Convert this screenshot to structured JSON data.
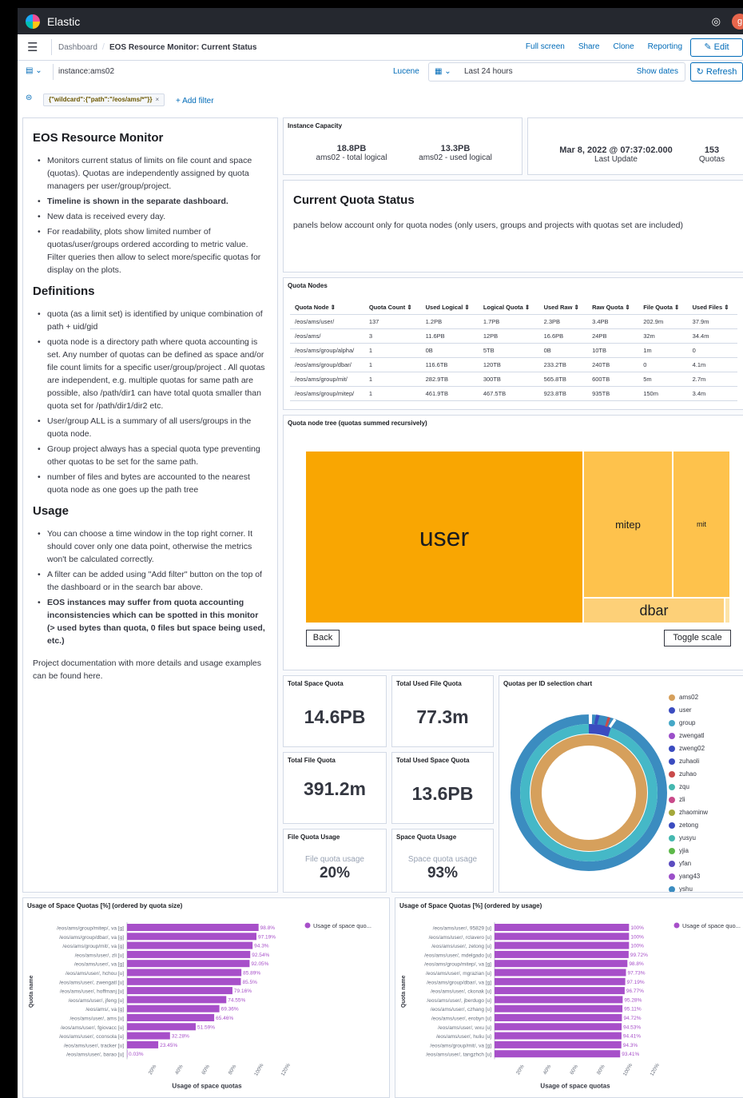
{
  "app": {
    "brand": "Elastic",
    "avatar": "g"
  },
  "nav": {
    "crumb_root": "Dashboard",
    "crumb_current": "EOS Resource Monitor: Current Status",
    "links": [
      "Full screen",
      "Share",
      "Clone",
      "Reporting"
    ],
    "edit": "Edit"
  },
  "query": {
    "value": "instance:ams02",
    "language": "Lucene",
    "time_range": "Last 24 hours",
    "show_dates": "Show dates",
    "refresh": "Refresh"
  },
  "filters": {
    "pill": "{\"wildcard\":{\"path\":\"/eos/ams/*\"}}",
    "add_filter": "+ Add filter"
  },
  "markdown": {
    "title": "EOS Resource Monitor",
    "intro": [
      "Monitors current status of limits on file count and space (quotas). Quotas are independently assigned by quota managers per user/group/project.",
      "Timeline is shown in the separate dashboard.",
      "New data is received every day.",
      "For readability, plots show limited number of quotas/user/groups ordered according to metric value. Filter queries then allow to select more/specific quotas for display on the plots."
    ],
    "definitions_title": "Definitions",
    "definitions": [
      "quota (as a limit set) is identified by unique combination of path + uid/gid",
      "quota node is a directory path where quota accounting is set. Any number of quotas can be defined as space and/or file count limits for a specific user/group/project . All quotas are independent, e.g. multiple quotas for same path are possible, also /path/dir1 can have total quota smaller than quota set for /path/dir1/dir2 etc.",
      "User/group ALL is a summary of all users/groups in the quota node.",
      "Group project always has a special quota type preventing other quotas to be set for the same path.",
      "number of files and bytes are accounted to the nearest quota node as one goes up the path tree"
    ],
    "usage_title": "Usage",
    "usage": [
      "You can choose a time window in the top right corner. It should cover only one data point, otherwise the metrics won't be calculated correctly.",
      "A filter can be added using \"Add filter\" button on the top of the dashboard or in the search bar above.",
      "EOS instances may suffer from quota accounting inconsistencies which can be spotted in this monitor (> used bytes than quota, 0 files but space being used, etc.)"
    ],
    "footer": "Project documentation with more details and usage examples can be found here."
  },
  "capacity": {
    "title": "Instance Capacity",
    "total_value": "18.8PB",
    "total_label": "ams02 - total logical",
    "used_value": "13.3PB",
    "used_label": "ams02 - used logical"
  },
  "update": {
    "date": "Mar 8, 2022 @ 07:37:02.000",
    "date_label": "Last Update",
    "quotas": "153",
    "quotas_label": "Quotas"
  },
  "status": {
    "title": "Current Quota Status",
    "text": "panels below account only for quota nodes (only users, groups and projects with quotas set are included)"
  },
  "quota_nodes": {
    "title": "Quota Nodes",
    "headers": [
      "Quota Node ⇕",
      "Quota Count ⇕",
      "Used Logical ⇕",
      "Logical Quota ⇕",
      "Used Raw ⇕",
      "Raw Quota ⇕",
      "File Quota ⇕",
      "Used Files ⇕"
    ],
    "rows": [
      [
        "/eos/ams/user/",
        "137",
        "1.2PB",
        "1.7PB",
        "2.3PB",
        "3.4PB",
        "202.9m",
        "37.9m"
      ],
      [
        "/eos/ams/",
        "3",
        "11.6PB",
        "12PB",
        "16.6PB",
        "24PB",
        "32m",
        "34.4m"
      ],
      [
        "/eos/ams/group/alpha/",
        "1",
        "0B",
        "5TB",
        "0B",
        "10TB",
        "1m",
        "0"
      ],
      [
        "/eos/ams/group/dbar/",
        "1",
        "116.6TB",
        "120TB",
        "233.2TB",
        "240TB",
        "0",
        "4.1m"
      ],
      [
        "/eos/ams/group/mit/",
        "1",
        "282.9TB",
        "300TB",
        "565.8TB",
        "600TB",
        "5m",
        "2.7m"
      ],
      [
        "/eos/ams/group/mitep/",
        "1",
        "461.9TB",
        "467.5TB",
        "923.8TB",
        "935TB",
        "150m",
        "3.4m"
      ]
    ]
  },
  "treemap": {
    "title": "Quota node tree (quotas summed recursively)",
    "cells": [
      "user",
      "mitep",
      "mit",
      "dbar"
    ],
    "back": "Back",
    "toggle": "Toggle scale",
    "colors": [
      "#f9a602",
      "#fec24c",
      "#fec24c",
      "#fdd078"
    ]
  },
  "metrics": {
    "total_space_quota": {
      "title": "Total Space Quota",
      "value": "14.6PB"
    },
    "total_used_file_quota": {
      "title": "Total Used File Quota",
      "value": "77.3m"
    },
    "total_file_quota": {
      "title": "Total File Quota",
      "value": "391.2m"
    },
    "total_used_space_quota": {
      "title": "Total Used Space Quota",
      "value": "13.6PB"
    },
    "file_quota_usage": {
      "title": "File Quota Usage",
      "label": "File quota usage",
      "value": "20%"
    },
    "space_quota_usage": {
      "title": "Space Quota Usage",
      "label": "Space quota usage",
      "value": "93%"
    }
  },
  "donut": {
    "title": "Quotas per ID selection chart",
    "legend": [
      {
        "name": "ams02",
        "color": "#d6a05c"
      },
      {
        "name": "user",
        "color": "#3b4cc0"
      },
      {
        "name": "group",
        "color": "#45a8c7"
      },
      {
        "name": "zwengatl",
        "color": "#9b4fc9"
      },
      {
        "name": "zweng02",
        "color": "#3b4cc0"
      },
      {
        "name": "zuhaoli",
        "color": "#3b4cc0"
      },
      {
        "name": "zuhao",
        "color": "#c94a4a"
      },
      {
        "name": "zqu",
        "color": "#45b8b0"
      },
      {
        "name": "zli",
        "color": "#c94a8a"
      },
      {
        "name": "zhaominw",
        "color": "#a4a83a"
      },
      {
        "name": "zetong",
        "color": "#3b4cc0"
      },
      {
        "name": "yusyu",
        "color": "#45b8b0"
      },
      {
        "name": "yjia",
        "color": "#5db84a"
      },
      {
        "name": "yfan",
        "color": "#5b4cc0"
      },
      {
        "name": "yang43",
        "color": "#9b4fc9"
      },
      {
        "name": "yshu",
        "color": "#3b8cc0"
      }
    ]
  },
  "chart_data": [
    {
      "type": "bar",
      "title": "Usage of Space Quotas [%] (ordered by quota size)",
      "xlabel": "Usage of space quotas",
      "ylabel": "Quota name",
      "legend": "Usage of space quo...",
      "xlim": [
        0,
        120
      ],
      "xticks": [
        "20%",
        "40%",
        "60%",
        "80%",
        "100%",
        "120%"
      ],
      "categories": [
        "/eos/ams/group/mitep/, va [g]",
        "/eos/ams/group/dbar/, va [g]",
        "/eos/ams/group/mit/, va [g]",
        "/eos/ams/user/, zli [u]",
        "/eos/ams/user/, va [g]",
        "/eos/ams/user/, hchou [u]",
        "/eos/ams/user/, zwengatl [u]",
        "/eos/ams/user/, hoffmanj [u]",
        "/eos/ams/user/, jfeng [u]",
        "/eos/ams/, va [g]",
        "/eos/ams/user/, ams [u]",
        "/eos/ams/user/, fgiovacc [u]",
        "/eos/ams/user/, cconsola [u]",
        "/eos/ams/user/, tracker [u]",
        "/eos/ams/user/, barao [u]"
      ],
      "values": [
        98.8,
        97.19,
        94.3,
        92.54,
        92.05,
        85.89,
        85.5,
        79.16,
        74.55,
        69.36,
        65.46,
        51.59,
        32.28,
        23.45,
        0.03
      ],
      "labels": [
        "98.8%",
        "97.19%",
        "94.3%",
        "92.54%",
        "92.05%",
        "85.89%",
        "85.5%",
        "79.16%",
        "74.55%",
        "69.36%",
        "65.46%",
        "51.59%",
        "32.28%",
        "23.45%",
        "0.03%"
      ],
      "color": "#a74fc9"
    },
    {
      "type": "bar",
      "title": "Usage of Space Quotas [%] (ordered by usage)",
      "xlabel": "Usage of space quotas",
      "ylabel": "Quota name",
      "legend": "Usage of space quo...",
      "xlim": [
        0,
        120
      ],
      "xticks": [
        "20%",
        "40%",
        "60%",
        "80%",
        "100%",
        "120%"
      ],
      "categories": [
        "/eos/ams/user/, 95829 [u]",
        "/eos/ams/user/, rclavero [u]",
        "/eos/ams/user/, zetong [u]",
        "/eos/ams/user/, mdelgado [u]",
        "/eos/ams/group/mitep/, va [g]",
        "/eos/ams/user/, mgrazian [u]",
        "/eos/ams/group/dbar/, va [g]",
        "/eos/ams/user/, ckonak [u]",
        "/eos/ams/user/, jberdugo [u]",
        "/eos/ams/user/, czhang [u]",
        "/eos/ams/user/, erobyn [u]",
        "/eos/ams/user/, wxu [u]",
        "/eos/ams/user/, huliu [u]",
        "/eos/ams/group/mit/, va [g]",
        "/eos/ams/user/, tangzhch [u]"
      ],
      "values": [
        100,
        100,
        100,
        99.72,
        98.8,
        97.73,
        97.19,
        96.77,
        95.28,
        95.11,
        94.72,
        94.53,
        94.41,
        94.3,
        93.41
      ],
      "labels": [
        "100%",
        "100%",
        "100%",
        "99.72%",
        "98.8%",
        "97.73%",
        "97.19%",
        "96.77%",
        "95.28%",
        "95.11%",
        "94.72%",
        "94.53%",
        "94.41%",
        "94.3%",
        "93.41%"
      ],
      "color": "#a74fc9"
    }
  ]
}
